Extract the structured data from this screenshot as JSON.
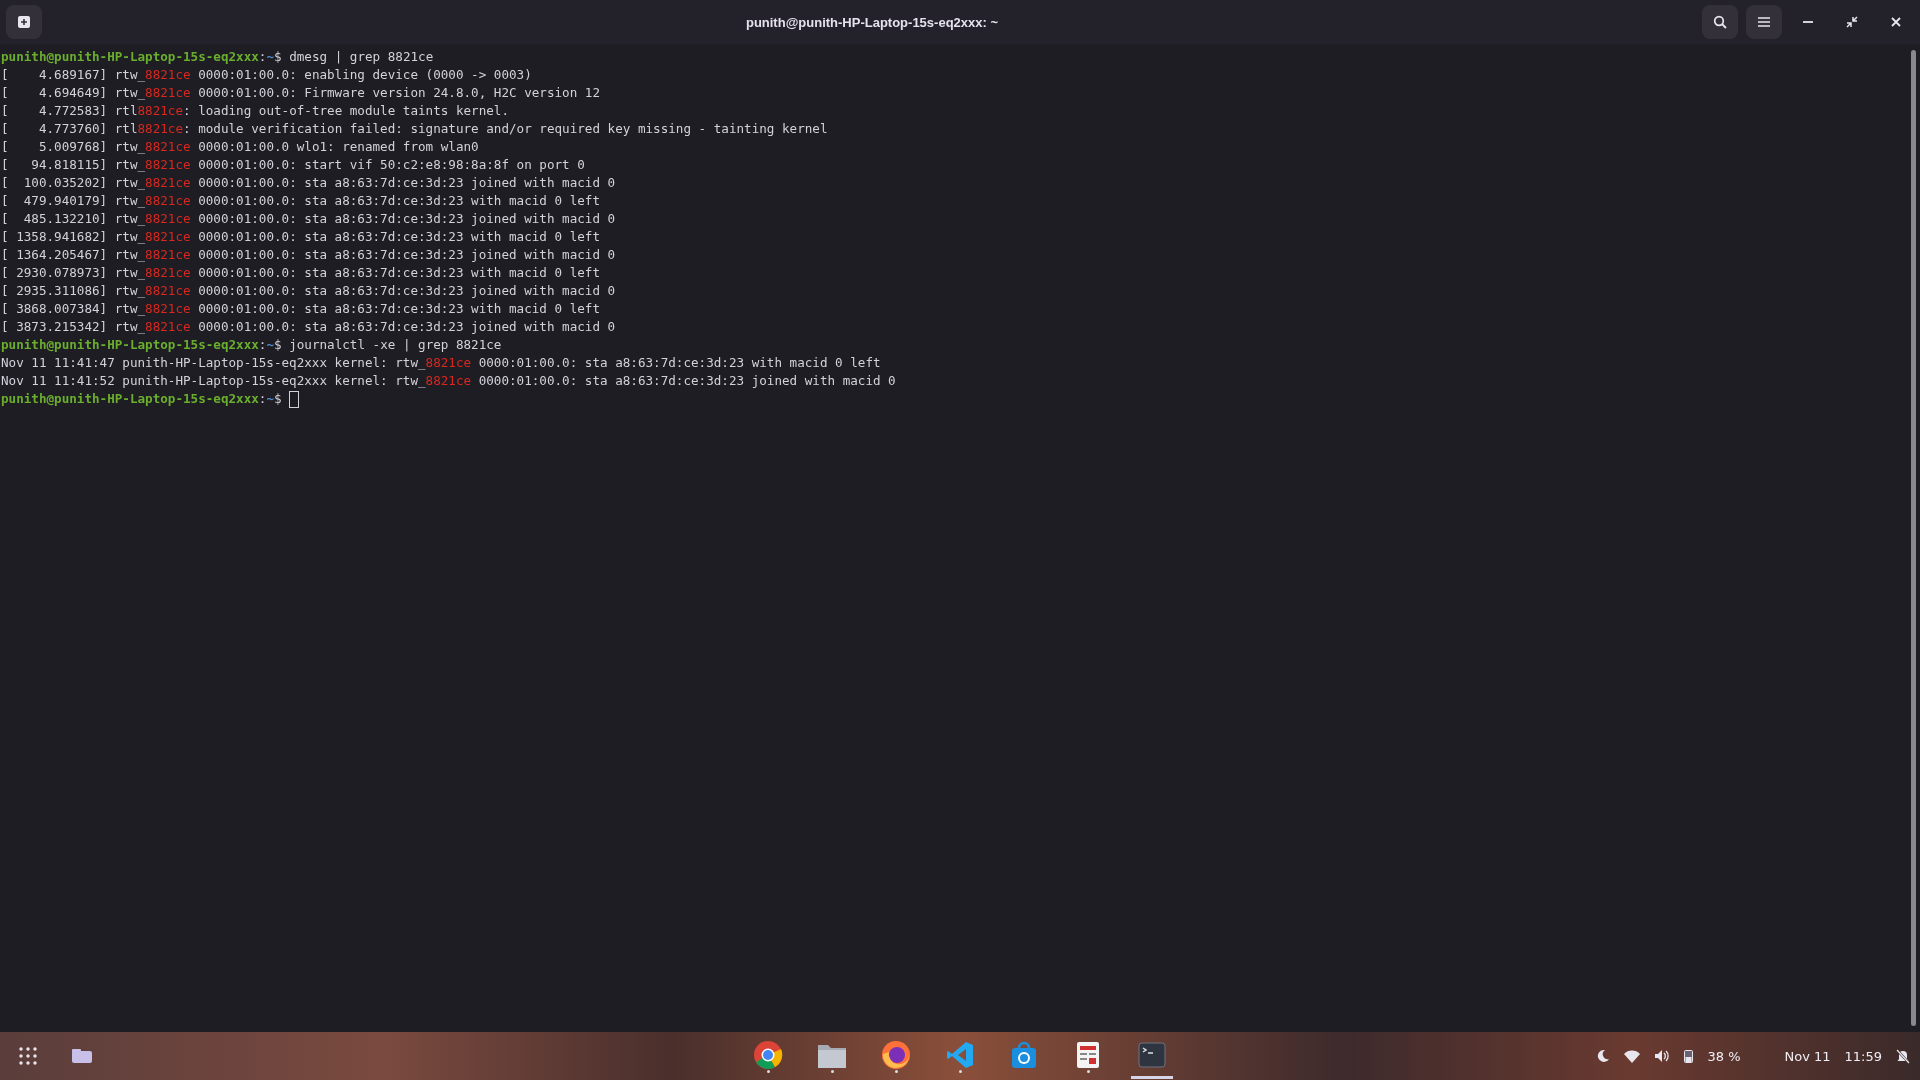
{
  "window": {
    "title": "punith@punith-HP-Laptop-15s-eq2xxx: ~"
  },
  "terminal": {
    "lines": [
      {
        "segments": [
          {
            "kind": "user",
            "text": "punith@punith-HP-Laptop-15s-eq2xxx"
          },
          {
            "kind": "plain",
            "text": ":"
          },
          {
            "kind": "path",
            "text": "~"
          },
          {
            "kind": "plain",
            "text": "$ dmesg | grep 8821ce"
          }
        ]
      },
      {
        "segments": [
          {
            "kind": "plain",
            "text": "[    4.689167] rtw_"
          },
          {
            "kind": "match",
            "text": "8821ce"
          },
          {
            "kind": "plain",
            "text": " 0000:01:00.0: enabling device (0000 -> 0003)"
          }
        ]
      },
      {
        "segments": [
          {
            "kind": "plain",
            "text": "[    4.694649] rtw_"
          },
          {
            "kind": "match",
            "text": "8821ce"
          },
          {
            "kind": "plain",
            "text": " 0000:01:00.0: Firmware version 24.8.0, H2C version 12"
          }
        ]
      },
      {
        "segments": [
          {
            "kind": "plain",
            "text": "[    4.772583] rtl"
          },
          {
            "kind": "match",
            "text": "8821ce"
          },
          {
            "kind": "plain",
            "text": ": loading out-of-tree module taints kernel."
          }
        ]
      },
      {
        "segments": [
          {
            "kind": "plain",
            "text": "[    4.773760] rtl"
          },
          {
            "kind": "match",
            "text": "8821ce"
          },
          {
            "kind": "plain",
            "text": ": module verification failed: signature and/or required key missing - tainting kernel"
          }
        ]
      },
      {
        "segments": [
          {
            "kind": "plain",
            "text": "[    5.009768] rtw_"
          },
          {
            "kind": "match",
            "text": "8821ce"
          },
          {
            "kind": "plain",
            "text": " 0000:01:00.0 wlo1: renamed from wlan0"
          }
        ]
      },
      {
        "segments": [
          {
            "kind": "plain",
            "text": "[   94.818115] rtw_"
          },
          {
            "kind": "match",
            "text": "8821ce"
          },
          {
            "kind": "plain",
            "text": " 0000:01:00.0: start vif 50:c2:e8:98:8a:8f on port 0"
          }
        ]
      },
      {
        "segments": [
          {
            "kind": "plain",
            "text": "[  100.035202] rtw_"
          },
          {
            "kind": "match",
            "text": "8821ce"
          },
          {
            "kind": "plain",
            "text": " 0000:01:00.0: sta a8:63:7d:ce:3d:23 joined with macid 0"
          }
        ]
      },
      {
        "segments": [
          {
            "kind": "plain",
            "text": "[  479.940179] rtw_"
          },
          {
            "kind": "match",
            "text": "8821ce"
          },
          {
            "kind": "plain",
            "text": " 0000:01:00.0: sta a8:63:7d:ce:3d:23 with macid 0 left"
          }
        ]
      },
      {
        "segments": [
          {
            "kind": "plain",
            "text": "[  485.132210] rtw_"
          },
          {
            "kind": "match",
            "text": "8821ce"
          },
          {
            "kind": "plain",
            "text": " 0000:01:00.0: sta a8:63:7d:ce:3d:23 joined with macid 0"
          }
        ]
      },
      {
        "segments": [
          {
            "kind": "plain",
            "text": "[ 1358.941682] rtw_"
          },
          {
            "kind": "match",
            "text": "8821ce"
          },
          {
            "kind": "plain",
            "text": " 0000:01:00.0: sta a8:63:7d:ce:3d:23 with macid 0 left"
          }
        ]
      },
      {
        "segments": [
          {
            "kind": "plain",
            "text": "[ 1364.205467] rtw_"
          },
          {
            "kind": "match",
            "text": "8821ce"
          },
          {
            "kind": "plain",
            "text": " 0000:01:00.0: sta a8:63:7d:ce:3d:23 joined with macid 0"
          }
        ]
      },
      {
        "segments": [
          {
            "kind": "plain",
            "text": "[ 2930.078973] rtw_"
          },
          {
            "kind": "match",
            "text": "8821ce"
          },
          {
            "kind": "plain",
            "text": " 0000:01:00.0: sta a8:63:7d:ce:3d:23 with macid 0 left"
          }
        ]
      },
      {
        "segments": [
          {
            "kind": "plain",
            "text": "[ 2935.311086] rtw_"
          },
          {
            "kind": "match",
            "text": "8821ce"
          },
          {
            "kind": "plain",
            "text": " 0000:01:00.0: sta a8:63:7d:ce:3d:23 joined with macid 0"
          }
        ]
      },
      {
        "segments": [
          {
            "kind": "plain",
            "text": "[ 3868.007384] rtw_"
          },
          {
            "kind": "match",
            "text": "8821ce"
          },
          {
            "kind": "plain",
            "text": " 0000:01:00.0: sta a8:63:7d:ce:3d:23 with macid 0 left"
          }
        ]
      },
      {
        "segments": [
          {
            "kind": "plain",
            "text": "[ 3873.215342] rtw_"
          },
          {
            "kind": "match",
            "text": "8821ce"
          },
          {
            "kind": "plain",
            "text": " 0000:01:00.0: sta a8:63:7d:ce:3d:23 joined with macid 0"
          }
        ]
      },
      {
        "segments": [
          {
            "kind": "user",
            "text": "punith@punith-HP-Laptop-15s-eq2xxx"
          },
          {
            "kind": "plain",
            "text": ":"
          },
          {
            "kind": "path",
            "text": "~"
          },
          {
            "kind": "plain",
            "text": "$ journalctl -xe | grep 8821ce"
          }
        ]
      },
      {
        "segments": [
          {
            "kind": "plain",
            "text": "Nov 11 11:41:47 punith-HP-Laptop-15s-eq2xxx kernel: rtw_"
          },
          {
            "kind": "match",
            "text": "8821ce"
          },
          {
            "kind": "plain",
            "text": " 0000:01:00.0: sta a8:63:7d:ce:3d:23 with macid 0 left"
          }
        ]
      },
      {
        "segments": [
          {
            "kind": "plain",
            "text": "Nov 11 11:41:52 punith-HP-Laptop-15s-eq2xxx kernel: rtw_"
          },
          {
            "kind": "match",
            "text": "8821ce"
          },
          {
            "kind": "plain",
            "text": " 0000:01:00.0: sta a8:63:7d:ce:3d:23 joined with macid 0"
          }
        ]
      },
      {
        "cursor": true,
        "segments": [
          {
            "kind": "user",
            "text": "punith@punith-HP-Laptop-15s-eq2xxx"
          },
          {
            "kind": "plain",
            "text": ":"
          },
          {
            "kind": "path",
            "text": "~"
          },
          {
            "kind": "plain",
            "text": "$ "
          }
        ]
      }
    ]
  },
  "taskbar": {
    "apps": [
      {
        "kind": "chrome",
        "running": true,
        "selected": false
      },
      {
        "kind": "files",
        "running": true,
        "selected": false
      },
      {
        "kind": "firefox",
        "running": true,
        "selected": false
      },
      {
        "kind": "vscode",
        "running": true,
        "selected": false
      },
      {
        "kind": "store",
        "running": false,
        "selected": false
      },
      {
        "kind": "editor",
        "running": true,
        "selected": false
      },
      {
        "kind": "terminal",
        "running": true,
        "selected": true
      }
    ],
    "battery": "38 %",
    "date": "Nov 11",
    "time": "11:59"
  }
}
